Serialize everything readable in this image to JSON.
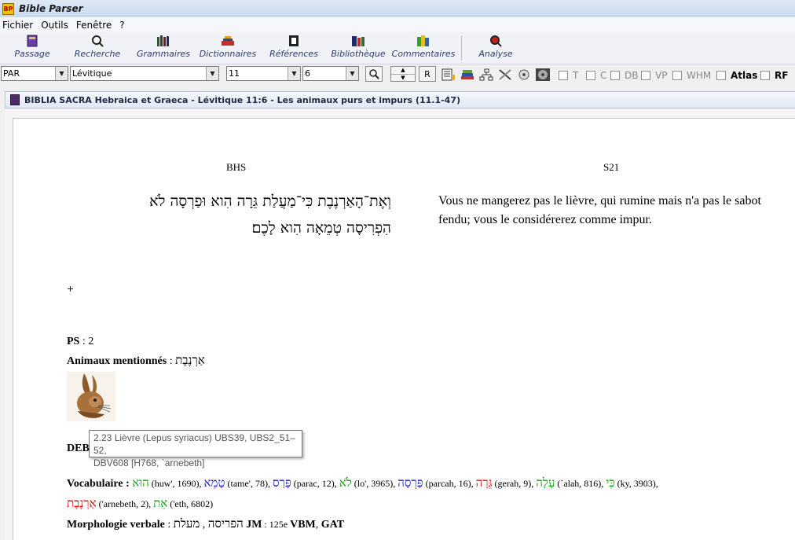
{
  "app": {
    "title": "Bible Parser",
    "icon_text": "BP"
  },
  "menu": [
    "Fichier",
    "Outils",
    "Fenêtre",
    "?"
  ],
  "toolbar": [
    {
      "label": "Passage",
      "icon": "book-icon"
    },
    {
      "label": "Recherche",
      "icon": "magnifier-icon"
    },
    {
      "label": "Grammaires",
      "icon": "grammar-books-icon"
    },
    {
      "label": "Dictionnaires",
      "icon": "dictionary-icon"
    },
    {
      "label": "Références",
      "icon": "references-icon"
    },
    {
      "label": "Bibliothèque",
      "icon": "library-icon"
    },
    {
      "label": "Commentaires",
      "icon": "comments-icon"
    },
    {
      "label": "Analyse",
      "icon": "analyse-icon"
    }
  ],
  "selectors": {
    "version": "PAR",
    "book": "Lévitique",
    "chapter": "11",
    "verse": "6",
    "r_button": "R"
  },
  "checkboxes": [
    {
      "label": "T",
      "checked": false
    },
    {
      "label": "C",
      "checked": false
    },
    {
      "label": "DB",
      "checked": false
    },
    {
      "label": "VP",
      "checked": false
    },
    {
      "label": "WHM",
      "checked": false
    },
    {
      "label": "Atlas",
      "checked": false
    },
    {
      "label": "RF",
      "checked": false
    }
  ],
  "document": {
    "window_title": "BIBLIA SACRA Hebraica et Graeca - Lévitique 11:6 - Les animaux purs et impurs (11.1-47)",
    "left_header": "BHS",
    "right_header": "S21",
    "hebrew_line1": "וְאֶת־הָאַרְנֶבֶת כִּי־מַעֲלַת גֵּרָה הִוא וּפַרְסָה לֹא",
    "hebrew_line2": "הִפְרִיסָה טְמֵאָה הִוא לָכֶם׃",
    "french_text": "Vous ne mangerez pas le lièvre, qui rumine mais n'a pas le sabot fendu; vous le considérerez comme impur.",
    "plus": "+",
    "ps_label": "PS",
    "ps_value": " : 2",
    "animals_label": "Animaux mentionnés",
    "animals_sep": " : ",
    "animals_value": "אַרְנֶבֶת",
    "tooltip_line1": "2.23 Lièvre (Lepus syriacus) UBS39, UBS2_51–52,",
    "tooltip_line2": "DBV608 [H768, `arnebeth]",
    "deb_label": "DEB",
    "vocab_label": "Vocabulaire :",
    "vocab": [
      {
        "heb": "הוּא",
        "gloss": " (huw', 1690), ",
        "color": "green"
      },
      {
        "heb": "טָמֵא",
        "gloss": " (tame', 78), ",
        "color": "blue"
      },
      {
        "heb": "פָּרַס",
        "gloss": " (parac, 12), ",
        "color": "blue"
      },
      {
        "heb": "לֹא",
        "gloss": " (lo', 3965), ",
        "color": "green"
      },
      {
        "heb": "פַּרְסָה",
        "gloss": " (parcah, 16), ",
        "color": "blue"
      },
      {
        "heb": "גֵּרָה",
        "gloss": " (gerah, 9), ",
        "color": "red"
      },
      {
        "heb": "עָלָה",
        "gloss": " (`alah, 816), ",
        "color": "green"
      },
      {
        "heb": "כִּי",
        "gloss": " (ky, 3903),",
        "color": "green"
      },
      {
        "heb": "אַרְנֶבֶת",
        "gloss": " ('arnebeth, 2), ",
        "color": "red"
      },
      {
        "heb": "אֵת",
        "gloss": " ('eth, 6802)",
        "color": "green"
      }
    ],
    "morph_label": "Morphologie verbale",
    "morph_sep": " : ",
    "morph_heb1": "הפריסה",
    "morph_comma": " , ",
    "morph_heb2": "מעלת",
    "morph_jm": " JM",
    "morph_rest": " : 125e ",
    "morph_vbm": "VBM",
    "morph_comma2": ", ",
    "morph_gat": "GAT"
  }
}
